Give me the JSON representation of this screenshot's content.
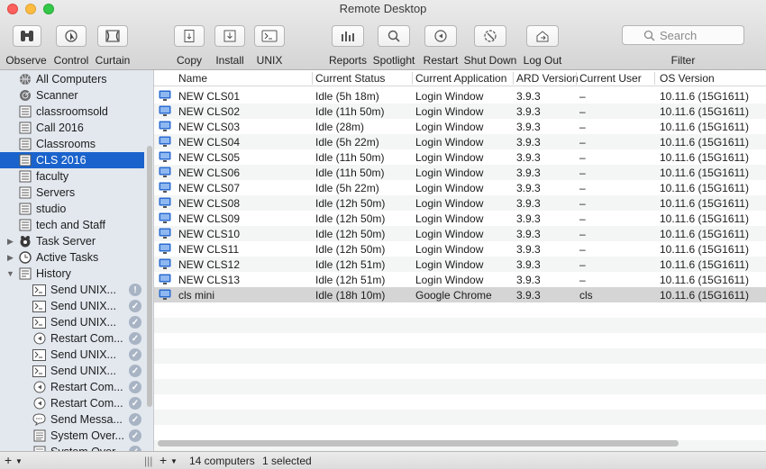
{
  "window": {
    "title": "Remote Desktop"
  },
  "toolbar": {
    "observe": "Observe",
    "control": "Control",
    "curtain": "Curtain",
    "copy": "Copy",
    "install": "Install",
    "unix": "UNIX",
    "reports": "Reports",
    "spotlight": "Spotlight",
    "restart": "Restart",
    "shutdown": "Shut Down",
    "logout": "Log Out",
    "filter": "Filter",
    "search_placeholder": "Search"
  },
  "sidebar": {
    "items": [
      {
        "label": "All Computers",
        "icon": "globe-icon"
      },
      {
        "label": "Scanner",
        "icon": "scanner-icon"
      },
      {
        "label": "classroomsold",
        "icon": "computer-list-icon"
      },
      {
        "label": "Call 2016",
        "icon": "computer-list-icon"
      },
      {
        "label": "Classrooms",
        "icon": "computer-list-icon"
      },
      {
        "label": "CLS 2016",
        "icon": "computer-list-icon",
        "selected": true
      },
      {
        "label": "faculty",
        "icon": "computer-list-icon"
      },
      {
        "label": "Servers",
        "icon": "computer-list-icon"
      },
      {
        "label": "studio",
        "icon": "computer-list-icon"
      },
      {
        "label": "tech and Staff",
        "icon": "computer-list-icon"
      },
      {
        "label": "Task Server",
        "icon": "task-server-icon",
        "disclosure": "collapsed"
      },
      {
        "label": "Active Tasks",
        "icon": "clock-icon",
        "disclosure": "collapsed"
      },
      {
        "label": "History",
        "icon": "history-icon",
        "disclosure": "expanded"
      }
    ],
    "history": [
      {
        "label": "Send UNIX...",
        "icon": "terminal-icon",
        "status": "!"
      },
      {
        "label": "Send UNIX...",
        "icon": "terminal-icon",
        "status": "✓"
      },
      {
        "label": "Send UNIX...",
        "icon": "terminal-icon",
        "status": "✓"
      },
      {
        "label": "Restart Com...",
        "icon": "restart-icon",
        "status": "✓"
      },
      {
        "label": "Send UNIX...",
        "icon": "terminal-icon",
        "status": "✓"
      },
      {
        "label": "Send UNIX...",
        "icon": "terminal-icon",
        "status": "✓"
      },
      {
        "label": "Restart Com...",
        "icon": "restart-icon",
        "status": "✓"
      },
      {
        "label": "Restart Com...",
        "icon": "restart-icon",
        "status": "✓"
      },
      {
        "label": "Send Messa...",
        "icon": "message-icon",
        "status": "✓"
      },
      {
        "label": "System Over...",
        "icon": "report-icon",
        "status": "✓"
      },
      {
        "label": "System Over...",
        "icon": "report-icon",
        "status": "✓"
      }
    ]
  },
  "table": {
    "columns": [
      "Name",
      "Current Status",
      "Current Application",
      "ARD Version",
      "Current User",
      "OS Version"
    ],
    "rows": [
      [
        "NEW CLS01",
        "Idle (5h 18m)",
        "Login Window",
        "3.9.3",
        "–",
        "10.11.6 (15G1611)"
      ],
      [
        "NEW CLS02",
        "Idle (11h 50m)",
        "Login Window",
        "3.9.3",
        "–",
        "10.11.6 (15G1611)"
      ],
      [
        "NEW CLS03",
        "Idle (28m)",
        "Login Window",
        "3.9.3",
        "–",
        "10.11.6 (15G1611)"
      ],
      [
        "NEW CLS04",
        "Idle (5h 22m)",
        "Login Window",
        "3.9.3",
        "–",
        "10.11.6 (15G1611)"
      ],
      [
        "NEW CLS05",
        "Idle (11h 50m)",
        "Login Window",
        "3.9.3",
        "–",
        "10.11.6 (15G1611)"
      ],
      [
        "NEW CLS06",
        "Idle (11h 50m)",
        "Login Window",
        "3.9.3",
        "–",
        "10.11.6 (15G1611)"
      ],
      [
        "NEW CLS07",
        "Idle (5h 22m)",
        "Login Window",
        "3.9.3",
        "–",
        "10.11.6 (15G1611)"
      ],
      [
        "NEW CLS08",
        "Idle (12h 50m)",
        "Login Window",
        "3.9.3",
        "–",
        "10.11.6 (15G1611)"
      ],
      [
        "NEW CLS09",
        "Idle (12h 50m)",
        "Login Window",
        "3.9.3",
        "–",
        "10.11.6 (15G1611)"
      ],
      [
        "NEW CLS10",
        "Idle (12h 50m)",
        "Login Window",
        "3.9.3",
        "–",
        "10.11.6 (15G1611)"
      ],
      [
        "NEW CLS11",
        "Idle (12h 50m)",
        "Login Window",
        "3.9.3",
        "–",
        "10.11.6 (15G1611)"
      ],
      [
        "NEW CLS12",
        "Idle (12h 51m)",
        "Login Window",
        "3.9.3",
        "–",
        "10.11.6 (15G1611)"
      ],
      [
        "NEW CLS13",
        "Idle (12h 51m)",
        "Login Window",
        "3.9.3",
        "–",
        "10.11.6 (15G1611)"
      ],
      [
        "cls mini",
        "Idle (18h 10m)",
        "Google Chrome",
        "3.9.3",
        "cls",
        "10.11.6 (15G1611)"
      ]
    ],
    "selected_row": 13
  },
  "status": {
    "add_button": "+",
    "computer_count": "14 computers",
    "selected_count": "1 selected"
  },
  "colors": {
    "selection_blue": "#1b63cc",
    "sidebar_bg": "#e3e8ef",
    "row_icon_blue": "#2a6bd1"
  }
}
